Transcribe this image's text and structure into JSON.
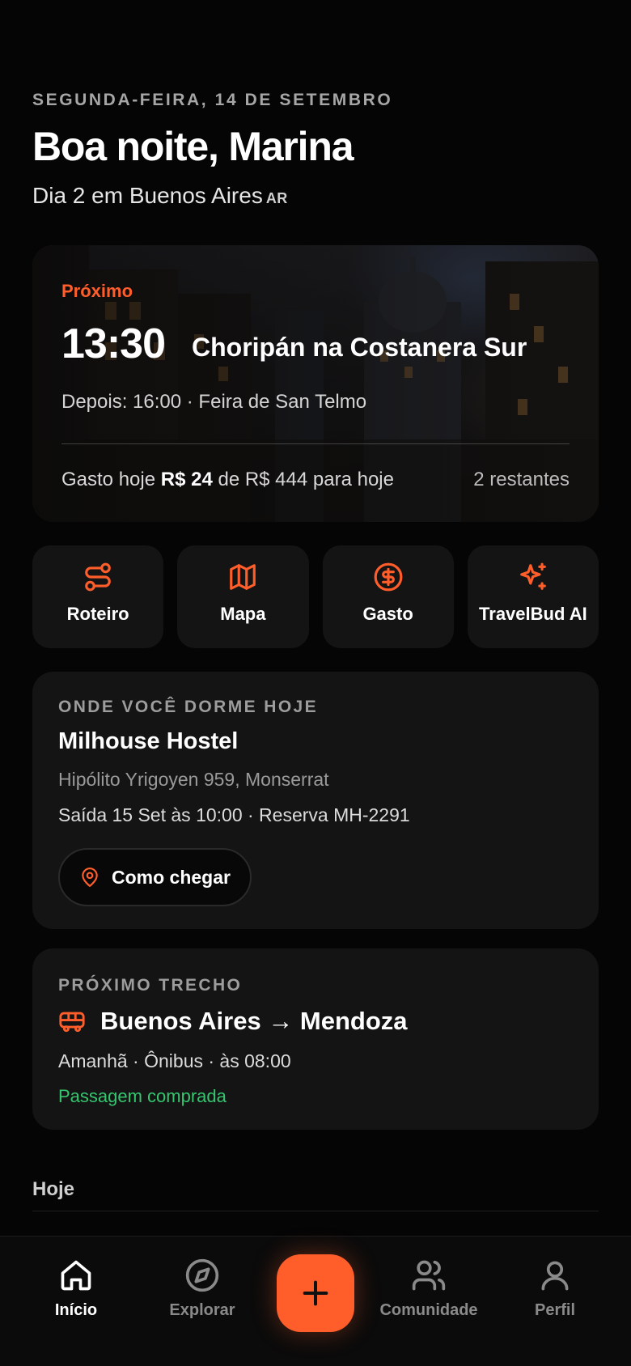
{
  "header": {
    "date": "SEGUNDA-FEIRA, 14 DE SETEMBRO",
    "greeting": "Boa noite, Marina",
    "subtitle": "Dia 2 em Buenos Aires",
    "country_code": "AR"
  },
  "next_event": {
    "label": "Próximo",
    "time": "13:30",
    "title": "Choripán na Costanera Sur",
    "after": "Depois: 16:00 · Feira de San Telmo",
    "spend_prefix": "Gasto hoje",
    "spend_amount": "R$ 24",
    "spend_suffix": "de R$ 444 para hoje",
    "remaining": "2 restantes"
  },
  "quick_actions": [
    {
      "label": "Roteiro",
      "icon": "route-icon"
    },
    {
      "label": "Mapa",
      "icon": "map-icon"
    },
    {
      "label": "Gasto",
      "icon": "dollar-icon"
    },
    {
      "label": "TravelBud AI",
      "icon": "sparkles-icon"
    }
  ],
  "stay": {
    "eyebrow": "ONDE VOCÊ DORME HOJE",
    "name": "Milhouse Hostel",
    "address": "Hipólito Yrigoyen 959, Monserrat",
    "checkout": "Saída 15 Set às 10:00 · Reserva MH-2291",
    "directions_label": "Como chegar"
  },
  "next_leg": {
    "eyebrow": "PRÓXIMO TRECHO",
    "route": "Buenos Aires → Mendoza",
    "meta": "Amanhã · Ônibus · às 08:00",
    "status": "Passagem comprada"
  },
  "section_today": "Hoje",
  "nav": {
    "items": [
      {
        "label": "Início",
        "icon": "home-icon",
        "active": true
      },
      {
        "label": "Explorar",
        "icon": "compass-icon",
        "active": false
      },
      {
        "label": "Comunidade",
        "icon": "users-icon",
        "active": false
      },
      {
        "label": "Perfil",
        "icon": "user-icon",
        "active": false
      }
    ],
    "fab_icon": "plus-icon"
  },
  "colors": {
    "accent": "#ff5e2b",
    "success": "#34c66f",
    "background": "#050505",
    "card": "#141414"
  }
}
